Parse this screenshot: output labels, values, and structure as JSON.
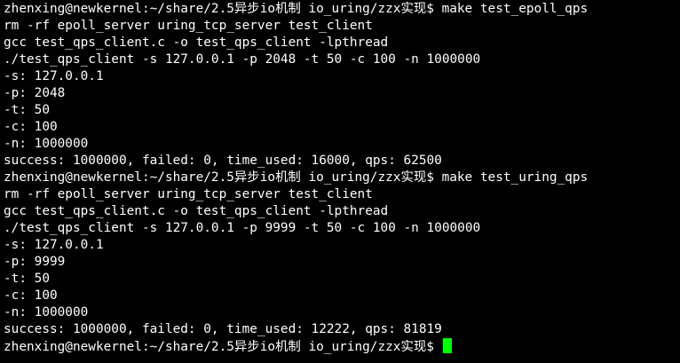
{
  "terminal": {
    "prompt": "zhenxing@newkernel:~/share/2.5异步io机制 io_uring/zzx实现$ ",
    "lines": [
      {
        "type": "prompt",
        "cmd": "make test_epoll_qps"
      },
      {
        "type": "out",
        "text": "rm -rf epoll_server uring_tcp_server test_client"
      },
      {
        "type": "out",
        "text": "gcc test_qps_client.c -o test_qps_client -lpthread"
      },
      {
        "type": "out",
        "text": "./test_qps_client -s 127.0.0.1 -p 2048 -t 50 -c 100 -n 1000000"
      },
      {
        "type": "out",
        "text": "-s: 127.0.0.1"
      },
      {
        "type": "out",
        "text": "-p: 2048"
      },
      {
        "type": "out",
        "text": "-t: 50"
      },
      {
        "type": "out",
        "text": "-c: 100"
      },
      {
        "type": "out",
        "text": "-n: 1000000"
      },
      {
        "type": "out",
        "text": "success: 1000000, failed: 0, time_used: 16000, qps: 62500"
      },
      {
        "type": "prompt",
        "cmd": "make test_uring_qps"
      },
      {
        "type": "out",
        "text": "rm -rf epoll_server uring_tcp_server test_client"
      },
      {
        "type": "out",
        "text": "gcc test_qps_client.c -o test_qps_client -lpthread"
      },
      {
        "type": "out",
        "text": "./test_qps_client -s 127.0.0.1 -p 9999 -t 50 -c 100 -n 1000000"
      },
      {
        "type": "out",
        "text": "-s: 127.0.0.1"
      },
      {
        "type": "out",
        "text": "-p: 9999"
      },
      {
        "type": "out",
        "text": "-t: 50"
      },
      {
        "type": "out",
        "text": "-c: 100"
      },
      {
        "type": "out",
        "text": "-n: 1000000"
      },
      {
        "type": "out",
        "text": "success: 1000000, failed: 0, time_used: 12222, qps: 81819"
      },
      {
        "type": "prompt",
        "cmd": "",
        "cursor": true
      }
    ],
    "colors": {
      "background": "#000000",
      "foreground": "#ffffff",
      "cursor": "#00ff00"
    }
  }
}
